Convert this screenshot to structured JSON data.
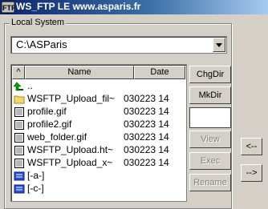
{
  "window": {
    "title": "WS_FTP LE www.asparis.fr",
    "icon": "ftp-app-icon"
  },
  "local_system": {
    "group_label": "Local System",
    "path": "C:\\ASParis",
    "columns": {
      "up": "^",
      "name": "Name",
      "date": "Date"
    },
    "files": [
      {
        "icon": "up-arrow-icon",
        "name": "..",
        "date": ""
      },
      {
        "icon": "folder-icon",
        "name": "WSFTP_Upload_fil~",
        "date": "030223 14"
      },
      {
        "icon": "image-file-icon",
        "name": "profile.gif",
        "date": "030223 14"
      },
      {
        "icon": "image-file-icon",
        "name": "profile2.gif",
        "date": "030223 14"
      },
      {
        "icon": "image-file-icon",
        "name": "web_folder.gif",
        "date": "030223 14"
      },
      {
        "icon": "image-file-icon",
        "name": "WSFTP_Upload.ht~",
        "date": "030223 14"
      },
      {
        "icon": "image-file-icon",
        "name": "WSFTP_Upload_x~",
        "date": "030223 14"
      },
      {
        "icon": "drive-icon",
        "name": "[-a-]",
        "date": ""
      },
      {
        "icon": "drive-icon",
        "name": "[-c-]",
        "date": ""
      }
    ],
    "buttons": {
      "chgdir": "ChgDir",
      "mkdir": "MkDir",
      "view": "View",
      "exec": "Exec",
      "rename": "Rename"
    }
  },
  "transfer": {
    "download": "<--",
    "upload": "-->"
  }
}
